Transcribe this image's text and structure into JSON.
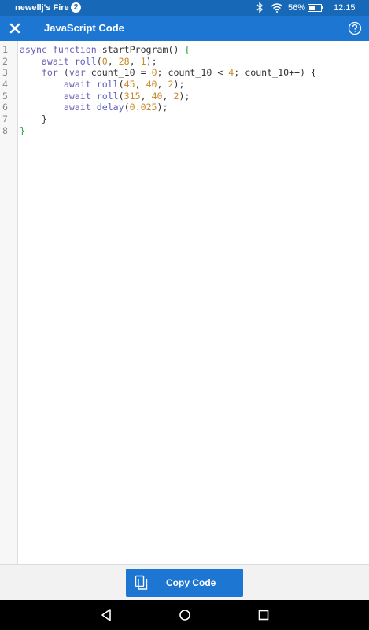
{
  "status_bar": {
    "device_name": "newellj's Fire",
    "notification_count": "2",
    "battery_percent": "56%",
    "time": "12:15"
  },
  "header": {
    "title": "JavaScript Code",
    "close_icon": "close-icon",
    "help_icon": "help-icon"
  },
  "code": {
    "line_numbers": [
      "1",
      "2",
      "3",
      "4",
      "5",
      "6",
      "7",
      "8"
    ],
    "line1": {
      "t1": "async function",
      "t2": " startProgram() ",
      "t3": "{"
    },
    "line2": {
      "t1": "await",
      "t2": "roll",
      "t3": "(",
      "t4": "0",
      "t5": ", ",
      "t6": "28",
      "t7": ", ",
      "t8": "1",
      "t9": ");"
    },
    "line3": {
      "t1": "for",
      "t2": " (",
      "t3": "var",
      "t4": " count_10 = ",
      "t5": "0",
      "t6": "; count_10 < ",
      "t7": "4",
      "t8": "; count_10++) {"
    },
    "line4": {
      "t1": "await",
      "t2": "roll",
      "t3": "(",
      "t4": "45",
      "t5": ", ",
      "t6": "40",
      "t7": ", ",
      "t8": "2",
      "t9": ");"
    },
    "line5": {
      "t1": "await",
      "t2": "roll",
      "t3": "(",
      "t4": "315",
      "t5": ", ",
      "t6": "40",
      "t7": ", ",
      "t8": "2",
      "t9": ");"
    },
    "line6": {
      "t1": "await",
      "t2": "delay",
      "t3": "(",
      "t4": "0.025",
      "t5": ");"
    },
    "line7": {
      "t1": "}"
    },
    "line8": {
      "t1": "}"
    }
  },
  "footer": {
    "copy_button_label": "Copy Code",
    "copy_icon": "copy-icon"
  },
  "nav_bar": {
    "back": "back-icon",
    "home": "home-icon",
    "recents": "recents-icon"
  },
  "colors": {
    "status_bar": "#1769b8",
    "app_bar": "#1d76d1",
    "button": "#1d76d1",
    "keyword": "#6d5fb5",
    "number": "#c98a2a",
    "brace": "#2ba52b"
  }
}
